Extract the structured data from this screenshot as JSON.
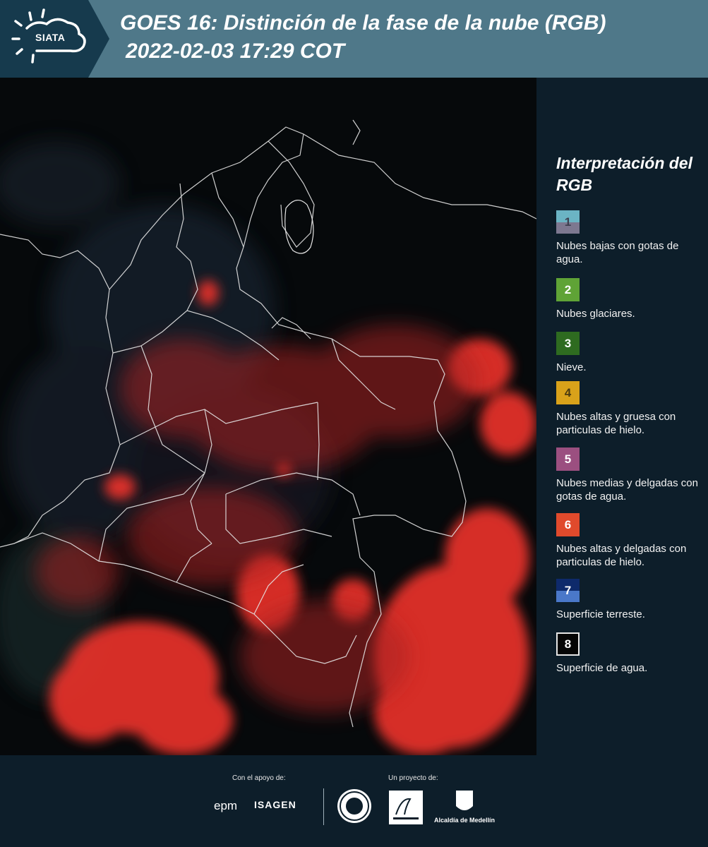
{
  "header": {
    "logo_text": "SIATA",
    "title": "GOES 16: Distinción de la fase de la nube (RGB)",
    "subtitle": "2022-02-03 17:29 COT"
  },
  "legend": {
    "title": "Interpretación del RGB",
    "items": [
      {
        "number": "1",
        "label": "Nubes bajas con gotas de agua.",
        "color_top": "#6bb4c4",
        "color_bottom": "#7d7890"
      },
      {
        "number": "2",
        "label": "Nubes glaciares.",
        "color": "#5fa336"
      },
      {
        "number": "3",
        "label": "Nieve.",
        "color": "#2e6b20"
      },
      {
        "number": "4",
        "label": "Nubes altas y gruesa con particulas de hielo.",
        "color": "#d9a21a"
      },
      {
        "number": "5",
        "label": "Nubes medias y delgadas con gotas de agua.",
        "color": "#9b4f80"
      },
      {
        "number": "6",
        "label": "Nubes altas y delgadas con particulas de hielo.",
        "color": "#e04a2c"
      },
      {
        "number": "7",
        "label": "Superficie terreste.",
        "color_top": "#0e2a6b",
        "color_bottom": "#4a78c9"
      },
      {
        "number": "8",
        "label": "Superficie de agua.",
        "color": "#050505"
      }
    ]
  },
  "footer": {
    "support_label": "Con el apoyo de:",
    "project_label": "Un proyecto de:",
    "sponsor_1": "epm",
    "sponsor_2": "ISAGEN",
    "partner_3": "Alcaldía de Medellín"
  }
}
